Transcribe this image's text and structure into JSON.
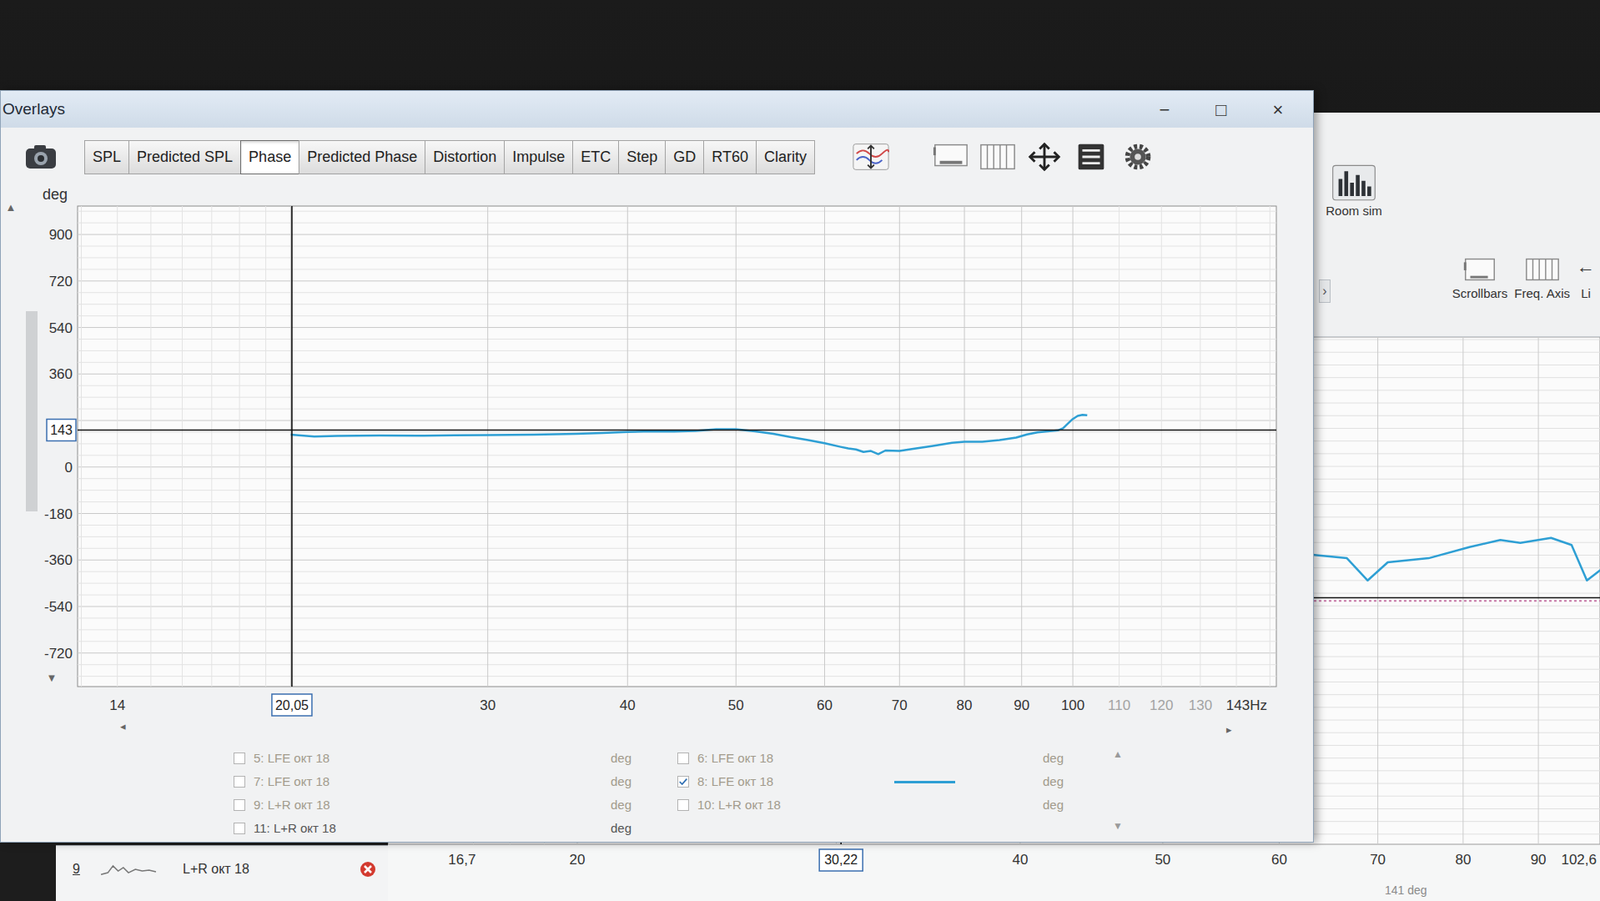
{
  "window": {
    "title": "Overlays",
    "controls": [
      "−",
      "□",
      "×"
    ]
  },
  "tabs": [
    {
      "label": "SPL",
      "selected": false
    },
    {
      "label": "Predicted SPL",
      "selected": false
    },
    {
      "label": "Phase",
      "selected": true
    },
    {
      "label": "Predicted Phase",
      "selected": false
    },
    {
      "label": "Distortion",
      "selected": false
    },
    {
      "label": "Impulse",
      "selected": false
    },
    {
      "label": "ETC",
      "selected": false
    },
    {
      "label": "Step",
      "selected": false
    },
    {
      "label": "GD",
      "selected": false
    },
    {
      "label": "RT60",
      "selected": false
    },
    {
      "label": "Clarity",
      "selected": false
    }
  ],
  "chart": {
    "y_unit": "deg",
    "y_ticks": [
      {
        "label": "900",
        "value": 900
      },
      {
        "label": "720",
        "value": 720
      },
      {
        "label": "540",
        "value": 540
      },
      {
        "label": "360",
        "value": 360
      },
      {
        "label": "0",
        "value": 0
      },
      {
        "label": "-180",
        "value": -180
      },
      {
        "label": "-360",
        "value": -360
      },
      {
        "label": "-540",
        "value": -540
      },
      {
        "label": "-720",
        "value": -720
      }
    ],
    "x_ticks": [
      {
        "label": "14",
        "value": 14,
        "dim": false
      },
      {
        "label": "30",
        "value": 30,
        "dim": false
      },
      {
        "label": "40",
        "value": 40,
        "dim": false
      },
      {
        "label": "50",
        "value": 50,
        "dim": false
      },
      {
        "label": "60",
        "value": 60,
        "dim": false
      },
      {
        "label": "70",
        "value": 70,
        "dim": false
      },
      {
        "label": "80",
        "value": 80,
        "dim": false
      },
      {
        "label": "90",
        "value": 90,
        "dim": false
      },
      {
        "label": "100",
        "value": 100,
        "dim": false
      },
      {
        "label": "110",
        "value": 110,
        "dim": true
      },
      {
        "label": "120",
        "value": 120,
        "dim": true
      },
      {
        "label": "130",
        "value": 130,
        "dim": true
      },
      {
        "label": "143Hz",
        "value": 143,
        "dim": false
      }
    ],
    "cursor": {
      "x_label": "20,05",
      "x_value": 20.05,
      "y_label": "143",
      "y_value": 143
    },
    "scroll_glyphs": {
      "up": "▲",
      "down": "▼",
      "left": "◂",
      "right": "▸"
    },
    "series": [
      {
        "color": "#2e9fd4",
        "freqs": [
          20,
          21,
          22,
          24,
          26,
          28,
          30,
          33,
          36,
          38,
          40,
          42,
          44,
          46,
          48,
          50,
          52,
          54,
          56,
          58,
          60,
          62,
          63,
          64,
          65,
          66,
          67,
          68,
          70,
          72,
          75,
          78,
          80,
          83,
          86,
          89,
          91,
          93,
          95,
          97,
          98,
          99,
          100,
          101,
          102,
          103
        ],
        "values": [
          125,
          118,
          120,
          122,
          121,
          123,
          124,
          125,
          128,
          132,
          136,
          138,
          137,
          140,
          146,
          146,
          138,
          128,
          116,
          104,
          92,
          78,
          72,
          68,
          58,
          62,
          50,
          64,
          62,
          70,
          82,
          94,
          98,
          98,
          104,
          114,
          126,
          134,
          138,
          142,
          150,
          168,
          186,
          198,
          202,
          200
        ]
      }
    ]
  },
  "legend": {
    "columns": [
      {
        "items": [
          {
            "label": "5: LFE окт 18",
            "unit": "deg",
            "checked": false,
            "dim": true
          },
          {
            "label": "7: LFE окт 18",
            "unit": "deg",
            "checked": false,
            "dim": true
          },
          {
            "label": "9: L+R окт 18",
            "unit": "deg",
            "checked": false,
            "dim": true
          },
          {
            "label": "11: L+R окт 18",
            "unit": "deg",
            "checked": false,
            "dim": false
          }
        ]
      },
      {
        "items": [
          {
            "label": "6: LFE окт 18",
            "unit": "deg",
            "checked": false,
            "dim": true
          },
          {
            "label": "8: LFE окт 18",
            "unit": "deg",
            "checked": true,
            "dim": true,
            "color": "#2e9fd4"
          },
          {
            "label": "10: L+R окт 18",
            "unit": "deg",
            "checked": false,
            "dim": true
          }
        ]
      }
    ],
    "scroll": [
      "▲",
      "▼"
    ]
  },
  "main_window": {
    "room_sim": {
      "label": "Room sim"
    },
    "side_glyph": "›",
    "view_buttons": [
      {
        "label": "Scrollbars",
        "kind": "scrollbars"
      },
      {
        "label": "Freq. Axis",
        "kind": "freqaxis"
      },
      {
        "label": "Li",
        "kind": "arrow"
      }
    ],
    "edge_glyph": "←",
    "chart": {
      "x_ticks": [
        {
          "label": "16,7",
          "value": 16.7
        },
        {
          "label": "20",
          "value": 20
        },
        {
          "label": "40",
          "value": 40
        },
        {
          "label": "50",
          "value": 50
        },
        {
          "label": "60",
          "value": 60
        },
        {
          "label": "70",
          "value": 70
        },
        {
          "label": "80",
          "value": 80
        },
        {
          "label": "90",
          "value": 90
        },
        {
          "label": "102,6",
          "value": 102.6
        }
      ],
      "cursor": {
        "x_label": "30,22",
        "x_value": 30.22,
        "y_value": 141
      },
      "reference": {
        "color": "#c77aa8",
        "value": 135
      },
      "series": [
        {
          "color": "#2e9fd4",
          "freqs": [
            55,
            59.6,
            63.6,
            66.7,
            68.9,
            71.1,
            75.8,
            80.8,
            84.8,
            87.5,
            91.8,
            94.8,
            97.1,
            99.1,
            101,
            103
          ],
          "values": [
            232,
            235,
            225,
            219,
            175,
            211,
            219,
            241,
            255,
            249,
            259,
            245,
            175,
            195,
            210,
            225
          ]
        }
      ]
    },
    "measurement": {
      "number": "9",
      "name": "L+R окт 18"
    },
    "status": "141 deg"
  }
}
